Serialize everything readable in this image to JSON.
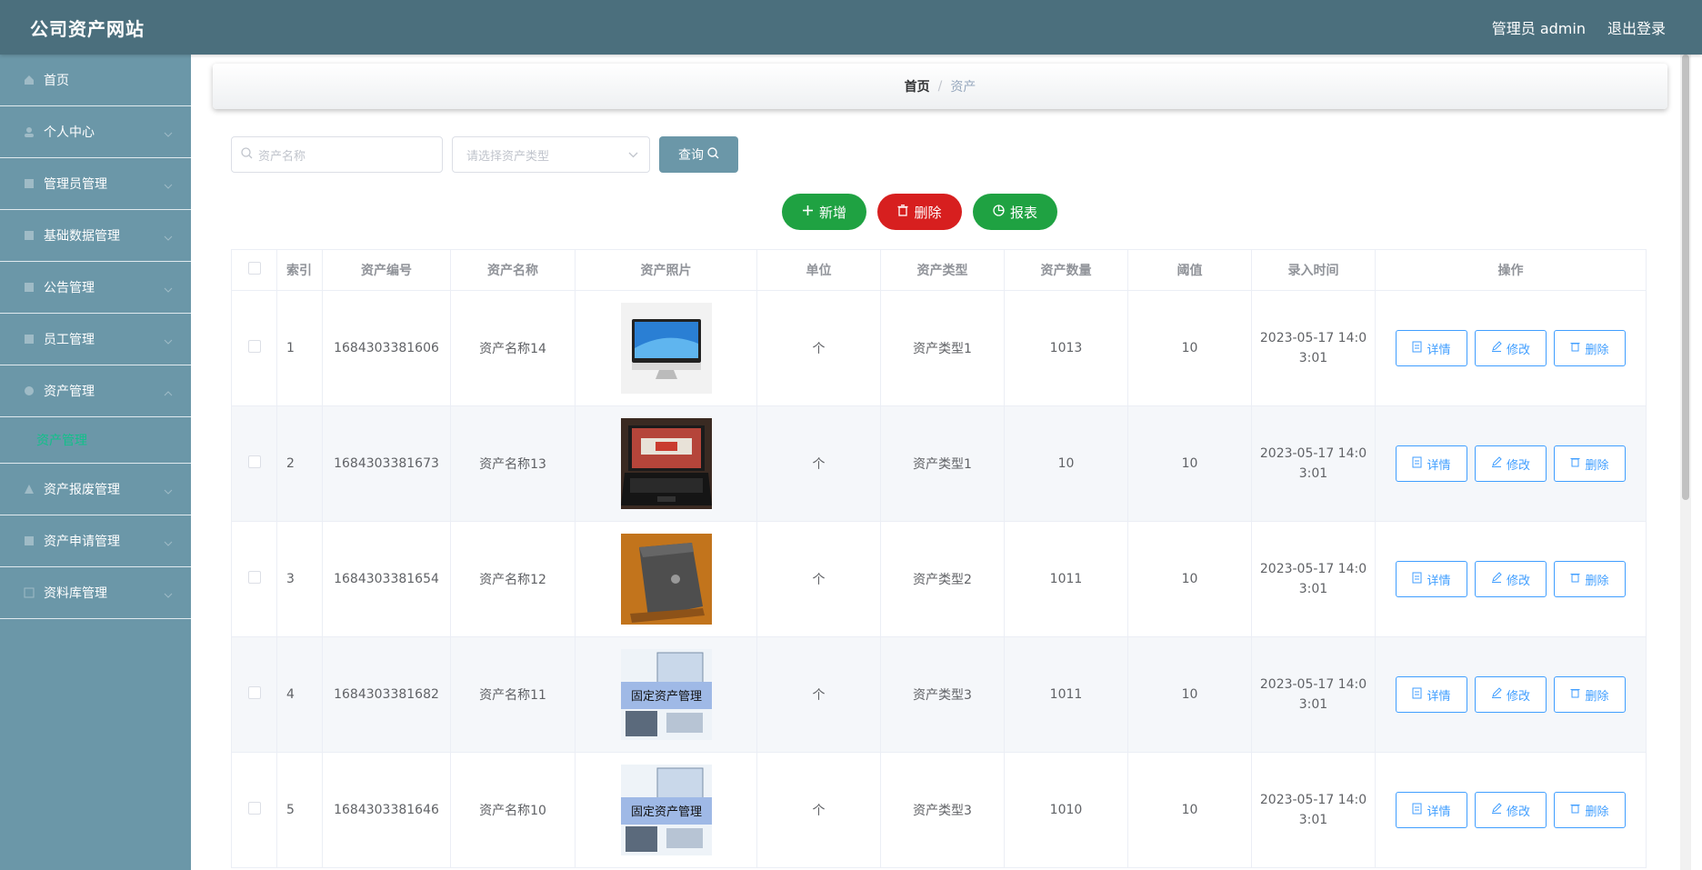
{
  "header": {
    "brand": "公司资产网站",
    "admin_label": "管理员 admin",
    "logout_label": "退出登录"
  },
  "sidebar": {
    "items": [
      {
        "label": "首页"
      },
      {
        "label": "个人中心"
      },
      {
        "label": "管理员管理"
      },
      {
        "label": "基础数据管理"
      },
      {
        "label": "公告管理"
      },
      {
        "label": "员工管理"
      },
      {
        "label": "资产管理"
      },
      {
        "label": "资产管理"
      },
      {
        "label": "资产报废管理"
      },
      {
        "label": "资产申请管理"
      },
      {
        "label": "资料库管理"
      }
    ]
  },
  "breadcrumb": {
    "home": "首页",
    "current": "资产"
  },
  "search": {
    "name_placeholder": "资产名称",
    "type_placeholder": "请选择资产类型",
    "query_label": "查询"
  },
  "actions": {
    "add": "新增",
    "delete": "删除",
    "report": "报表"
  },
  "table": {
    "headers": [
      "索引",
      "资产编号",
      "资产名称",
      "资产照片",
      "单位",
      "资产类型",
      "资产数量",
      "阈值",
      "录入时间",
      "操作"
    ],
    "rows": [
      {
        "index": "1",
        "code": "1684303381606",
        "name": "资产名称14",
        "photo": "imac",
        "unit": "个",
        "type": "资产类型1",
        "qty": "1013",
        "threshold": "10",
        "time1": "2023-05-17 14:0",
        "time2": "3:01"
      },
      {
        "index": "2",
        "code": "1684303381673",
        "name": "资产名称13",
        "photo": "laptop-open",
        "unit": "个",
        "type": "资产类型1",
        "qty": "10",
        "threshold": "10",
        "time1": "2023-05-17 14:0",
        "time2": "3:01"
      },
      {
        "index": "3",
        "code": "1684303381654",
        "name": "资产名称12",
        "photo": "laptop-closed",
        "unit": "个",
        "type": "资产类型2",
        "qty": "1011",
        "threshold": "10",
        "time1": "2023-05-17 14:0",
        "time2": "3:01"
      },
      {
        "index": "4",
        "code": "1684303381682",
        "name": "资产名称11",
        "photo": "fixed-asset-banner",
        "unit": "个",
        "type": "资产类型3",
        "qty": "1011",
        "threshold": "10",
        "time1": "2023-05-17 14:0",
        "time2": "3:01"
      },
      {
        "index": "5",
        "code": "1684303381646",
        "name": "资产名称10",
        "photo": "fixed-asset-banner",
        "unit": "个",
        "type": "资产类型3",
        "qty": "1010",
        "threshold": "10",
        "time1": "2023-05-17 14:0",
        "time2": "3:01"
      }
    ],
    "op_labels": {
      "detail": "详情",
      "edit": "修改",
      "delete": "删除"
    },
    "photo_text": "固定资产管理"
  },
  "colors": {
    "topbar": "#4b6f7d",
    "sidebar": "#6b97a8",
    "active_submenu": "#11c08a",
    "add": "#1fa242",
    "delete": "#d71f1f",
    "warning_qty": "#e5241f",
    "op_border": "#409eff"
  }
}
